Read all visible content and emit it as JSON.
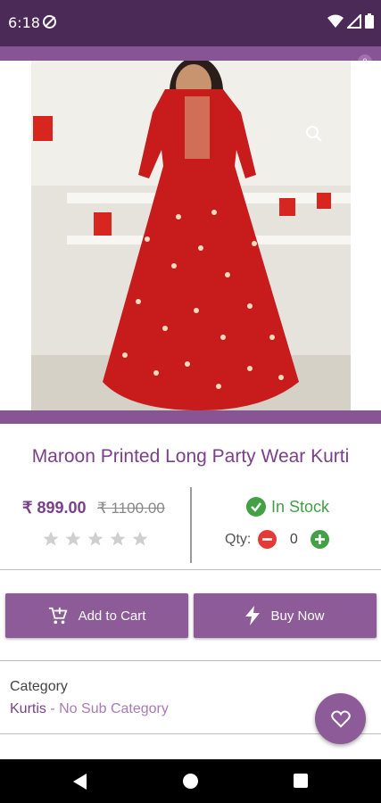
{
  "status_bar": {
    "time": "6:18"
  },
  "cart": {
    "badge_count": "0"
  },
  "product": {
    "title": "Maroon Printed Long Party Wear Kurti",
    "price": "₹ 899.00",
    "old_price": "₹ 1100.00",
    "rating_stars": 0,
    "stock_status": "In Stock",
    "qty_label": "Qty:",
    "qty_value": "0",
    "image_icon": "dress-photo"
  },
  "actions": {
    "add_to_cart": "Add to Cart",
    "buy_now": "Buy Now"
  },
  "category": {
    "label": "Category",
    "name": "Kurtis",
    "separator": " - ",
    "sub": "No Sub Category"
  },
  "colors": {
    "primary": "#875594",
    "status_bar": "#4c2a57",
    "in_stock": "#43a047",
    "minus": "#e53935",
    "plus": "#43a047"
  }
}
